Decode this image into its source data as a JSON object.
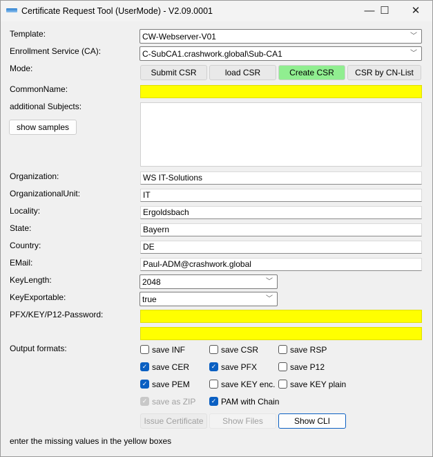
{
  "window": {
    "title": "Certificate Request Tool (UserMode) - V2.09.0001",
    "minimize": "—",
    "maximize": "☐",
    "close": "✕"
  },
  "labels": {
    "template": "Template:",
    "ca": "Enrollment Service (CA):",
    "mode": "Mode:",
    "cn": "CommonName:",
    "subjects": "additional Subjects:",
    "org": "Organization:",
    "ou": "OrganizationalUnit:",
    "locality": "Locality:",
    "state": "State:",
    "country": "Country:",
    "email": "EMail:",
    "keylength": "KeyLength:",
    "keyexp": "KeyExportable:",
    "password": "PFX/KEY/P12-Password:",
    "output": "Output formats:"
  },
  "template": "CW-Webserver-V01",
  "ca": "C-SubCA1.crashwork.global\\Sub-CA1",
  "mode_buttons": [
    "Submit CSR",
    "load CSR",
    "Create CSR",
    "CSR by CN-List"
  ],
  "active_mode_color": "#90ee90",
  "show_samples": "show samples",
  "fields": {
    "cn": "",
    "subjects": "",
    "org": "WS IT-Solutions",
    "ou": "IT",
    "locality": "Ergoldsbach",
    "state": "Bayern",
    "country": "DE",
    "email": "Paul-ADM@crashwork.global",
    "password": "",
    "password_confirm": ""
  },
  "keylength": "2048",
  "keyexp": "true",
  "checkboxes": [
    {
      "label": "save INF",
      "checked": false
    },
    {
      "label": "save CSR",
      "checked": false
    },
    {
      "label": "save RSP",
      "checked": false
    },
    {
      "label": "save CER",
      "checked": true
    },
    {
      "label": "save PFX",
      "checked": true
    },
    {
      "label": "save P12",
      "checked": false
    },
    {
      "label": "save PEM",
      "checked": true
    },
    {
      "label": "save KEY enc.",
      "checked": false
    },
    {
      "label": "save KEY plain",
      "checked": false
    },
    {
      "label": "save as ZIP",
      "checked": true,
      "disabled": true
    },
    {
      "label": "PAM with Chain",
      "checked": true
    }
  ],
  "actions": {
    "issue": "Issue Certificate",
    "files": "Show Files",
    "cli": "Show CLI"
  },
  "status": "enter the missing values in the yellow boxes",
  "required_color": "#ffff00"
}
